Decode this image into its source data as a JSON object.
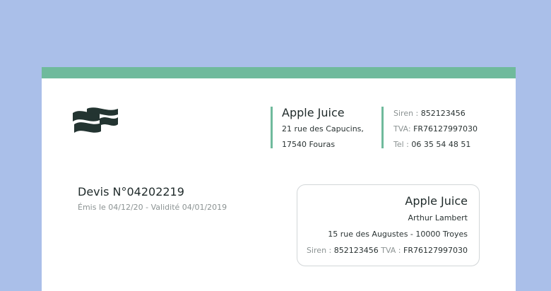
{
  "issuer": {
    "name": "Apple Juice",
    "address_line1": "21 rue des Capucins,",
    "address_line2": "17540 Fouras"
  },
  "legal": {
    "siren_label": "Siren :",
    "siren_value": "852123456",
    "tva_label": "TVA:",
    "tva_value": "FR76127997030",
    "tel_label": "Tel :",
    "tel_value": "06 35 54 48 51"
  },
  "quote": {
    "title": "Devis N°04202219",
    "dates": "Émis le 04/12/20 - Validité 04/01/2019"
  },
  "client": {
    "company": "Apple Juice",
    "contact": "Arthur Lambert",
    "address": "15 rue des Augustes - 10000 Troyes",
    "siren_label": "Siren :",
    "siren_value": "852123456",
    "tva_label": "TVA :",
    "tva_value": "FR76127997030"
  },
  "colors": {
    "background": "#aabfe9",
    "accent": "#6fba9c",
    "logo": "#233431"
  },
  "icons": {
    "logo": "wave-flag-logo-icon"
  }
}
